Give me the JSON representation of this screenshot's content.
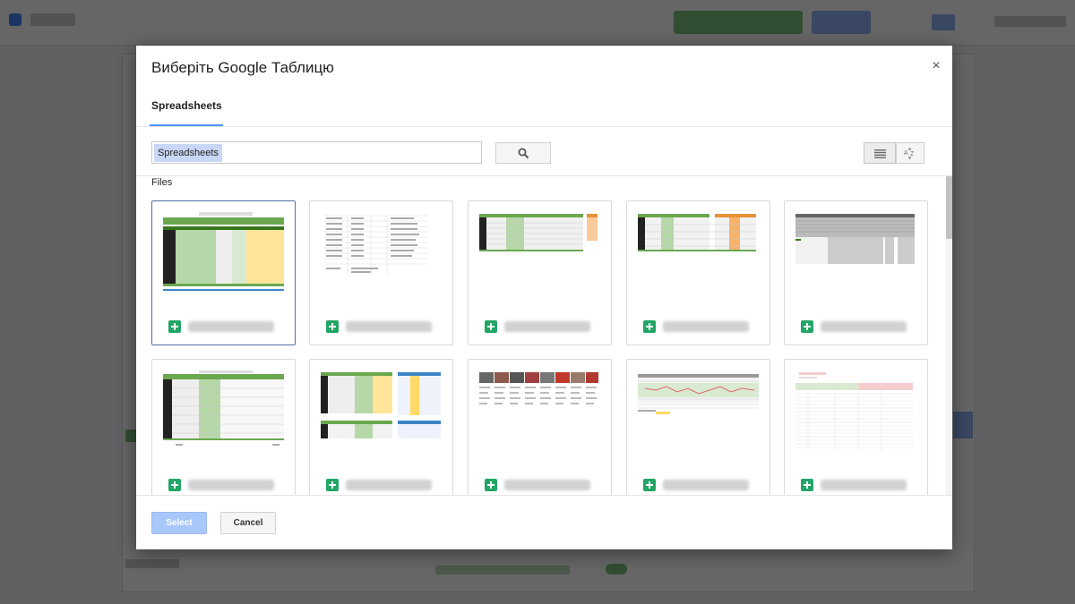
{
  "dialog": {
    "title": "Виберіть Google Таблицю",
    "close_glyph": "×",
    "tab_label": "Spreadsheets",
    "search_value": "Spreadsheets",
    "files_label": "Files",
    "select_label": "Select",
    "cancel_label": "Cancel"
  },
  "icons": {
    "close": "close-icon",
    "search": "search-icon",
    "list_view": "list-view-icon",
    "sort": "sort-az-icon",
    "file_type": "google-sheets-icon"
  },
  "colors": {
    "accent": "#4d90fe",
    "select_button": "#a8c7fa",
    "sheets_green": "#23a566",
    "thumb_green": "#6aa84f",
    "thumb_orange": "#e69138",
    "thumb_yellow": "#ffe599"
  },
  "files": [
    {
      "thumb": "green-yellow",
      "selected": true
    },
    {
      "thumb": "plain-table",
      "selected": false
    },
    {
      "thumb": "green-orange-small",
      "selected": false
    },
    {
      "thumb": "green-orange",
      "selected": false
    },
    {
      "thumb": "gray-table",
      "selected": false
    },
    {
      "thumb": "dark-green",
      "selected": false
    },
    {
      "thumb": "blue-panels",
      "selected": false
    },
    {
      "thumb": "photo-row",
      "selected": false
    },
    {
      "thumb": "chart-pink",
      "selected": false
    },
    {
      "thumb": "red-header",
      "selected": false
    }
  ]
}
